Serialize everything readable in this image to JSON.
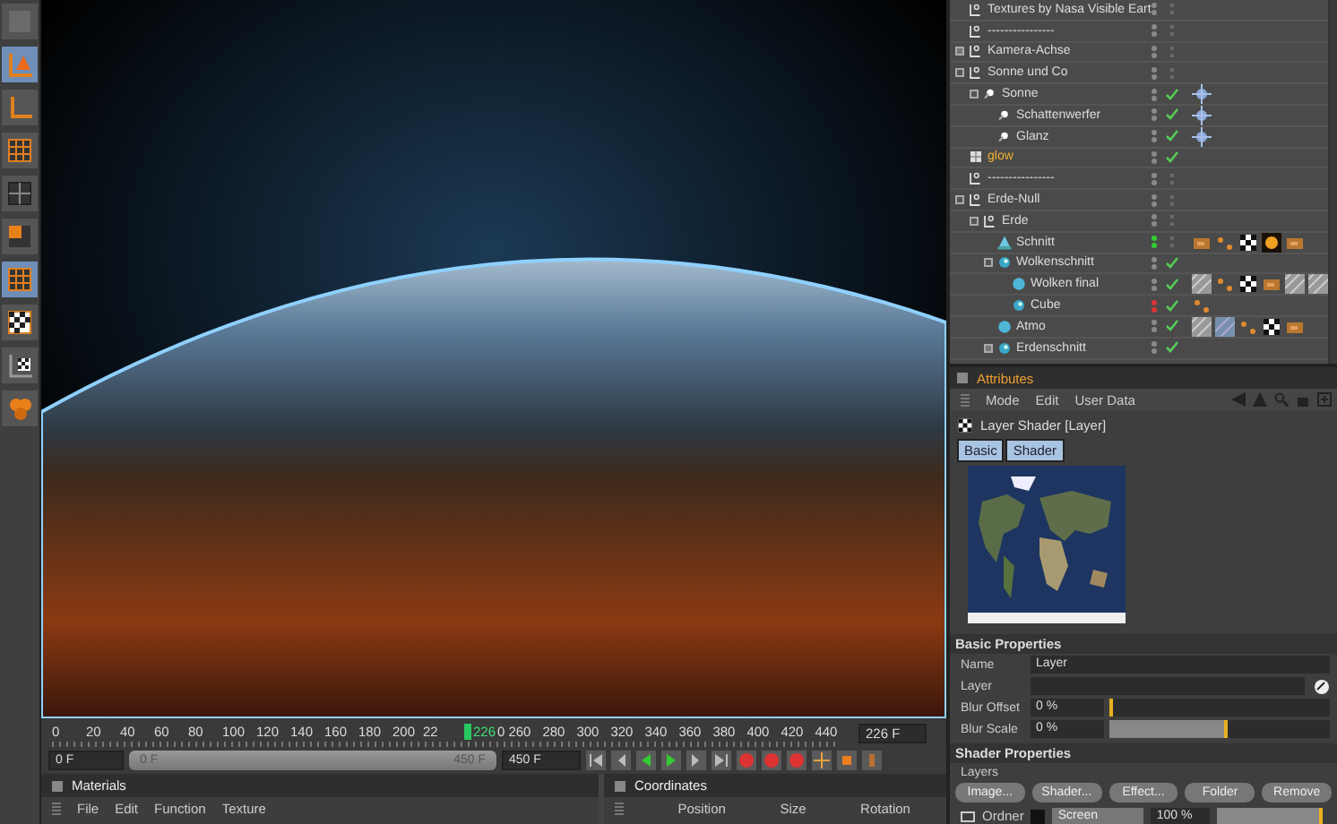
{
  "toolbar": {
    "tools": [
      {
        "kind": "blank",
        "selected": false
      },
      {
        "kind": "axis-cone",
        "selected": true
      },
      {
        "kind": "axis",
        "selected": false
      },
      {
        "kind": "grid-points",
        "selected": false
      },
      {
        "kind": "grid",
        "selected": false
      },
      {
        "kind": "grid-fill",
        "selected": false
      },
      {
        "kind": "grid-points",
        "selected": true
      },
      {
        "kind": "checker",
        "selected": false
      },
      {
        "kind": "axis-checker",
        "selected": false
      },
      {
        "kind": "spheres",
        "selected": false
      }
    ]
  },
  "objects": {
    "items": [
      {
        "name": "Textures by Nasa Visible Eart",
        "kind": "null",
        "color": "#8a8a8a",
        "enabled": false
      },
      {
        "name": "----------------",
        "kind": "null",
        "color": "#8a8a8a",
        "enabled": false
      },
      {
        "name": "Kamera-Achse",
        "kind": "null",
        "expanded": false,
        "color": "#8a8a8a",
        "enabled": false
      },
      {
        "name": "Sonne und Co",
        "kind": "null",
        "expanded": true,
        "color": "#8a8a8a",
        "enabled": false,
        "children": [
          {
            "name": "Sonne",
            "kind": "light",
            "expanded": true,
            "color": "#8a8a8a",
            "enabled": true,
            "tags": [
              {
                "kind": "target"
              }
            ],
            "children": [
              {
                "name": "Schattenwerfer",
                "kind": "light",
                "color": "#8a8a8a",
                "enabled": true,
                "tags": [
                  {
                    "kind": "target"
                  }
                ]
              },
              {
                "name": "Glanz",
                "kind": "light",
                "color": "#8a8a8a",
                "enabled": true,
                "tags": [
                  {
                    "kind": "target"
                  }
                ]
              }
            ]
          }
        ]
      },
      {
        "name": "glow",
        "kind": "effect",
        "color": "#8a8a8a",
        "enabled": true
      },
      {
        "name": "----------------",
        "kind": "null",
        "color": "#8a8a8a",
        "enabled": false
      },
      {
        "name": "Erde-Null",
        "kind": "null",
        "expanded": true,
        "color": "#8a8a8a",
        "enabled": false,
        "children": [
          {
            "name": "Erde",
            "kind": "null",
            "expanded": true,
            "color": "#8a8a8a",
            "enabled": false,
            "children": [
              {
                "name": "Schnitt",
                "kind": "cone",
                "color": "#33cc33",
                "enabled": false,
                "tags": [
                  {
                    "kind": "texture"
                  },
                  {
                    "kind": "phong"
                  },
                  {
                    "kind": "checker"
                  },
                  {
                    "kind": "sun"
                  },
                  {
                    "kind": "texture"
                  }
                ]
              },
              {
                "name": "Wolkenschnitt",
                "kind": "boole",
                "expanded": true,
                "color": "#8a8a8a",
                "enabled": true,
                "children": [
                  {
                    "name": "Wolken final",
                    "kind": "sphere",
                    "color": "#8a8a8a",
                    "enabled": true,
                    "tags": [
                      {
                        "kind": "hatch"
                      },
                      {
                        "kind": "phong"
                      },
                      {
                        "kind": "checker"
                      },
                      {
                        "kind": "texture"
                      },
                      {
                        "kind": "hatch"
                      },
                      {
                        "kind": "hatch"
                      }
                    ]
                  },
                  {
                    "name": "Cube",
                    "kind": "boole",
                    "color": "#dd3333",
                    "enabled": true,
                    "tags": [
                      {
                        "kind": "phong"
                      }
                    ]
                  }
                ]
              },
              {
                "name": "Atmo",
                "kind": "sphere",
                "color": "#8a8a8a",
                "enabled": true,
                "tags": [
                  {
                    "kind": "hatch"
                  },
                  {
                    "kind": "shaded-hatch"
                  },
                  {
                    "kind": "phong"
                  },
                  {
                    "kind": "checker"
                  },
                  {
                    "kind": "texture"
                  }
                ]
              },
              {
                "name": "Erdenschnitt",
                "kind": "boole",
                "expanded": false,
                "color": "#8a8a8a",
                "enabled": true
              }
            ]
          }
        ]
      }
    ]
  },
  "attributes": {
    "title": "Attributes",
    "menu": [
      "Mode",
      "Edit",
      "User Data"
    ],
    "heading": "Layer Shader [Layer]",
    "tabs": [
      {
        "label": "Basic",
        "selected": true
      },
      {
        "label": "Shader",
        "selected": true
      }
    ],
    "sections": [
      {
        "title": "Basic Properties"
      },
      {
        "title": "Shader Properties"
      }
    ],
    "name_field": {
      "label": "Name",
      "value": "Layer"
    },
    "layer_field": {
      "label": "Layer"
    },
    "sliders": [
      {
        "label": "Blur Offset",
        "reading": "0 %",
        "level": 0
      },
      {
        "label": "Blur Scale",
        "reading": "0 %",
        "level": 0.52
      }
    ],
    "group": "Layers",
    "buttons": [
      "Image...",
      "Shader...",
      "Effect...",
      "Folder",
      "Remove"
    ],
    "layer_row": {
      "name": "Ordner",
      "mode": "Screen",
      "reading": "100 %",
      "level": 1
    }
  },
  "timeline": {
    "ticks": [
      "0",
      "20",
      "40",
      "60",
      "80",
      "100",
      "120",
      "140",
      "160",
      "180",
      "200",
      "22",
      "0",
      "260",
      "280",
      "300",
      "320",
      "340",
      "360",
      "380",
      "400",
      "420",
      "440"
    ],
    "current": "226",
    "current_field": "226 F",
    "start": "0 F",
    "range": {
      "start": "0 F",
      "end": "450 F",
      "level": 1
    },
    "end": "450 F"
  },
  "materials": {
    "title": "Materials",
    "menu": [
      "File",
      "Edit",
      "Function",
      "Texture"
    ]
  },
  "coordinates": {
    "title": "Coordinates",
    "columns": [
      "Position",
      "Size",
      "Rotation"
    ]
  }
}
